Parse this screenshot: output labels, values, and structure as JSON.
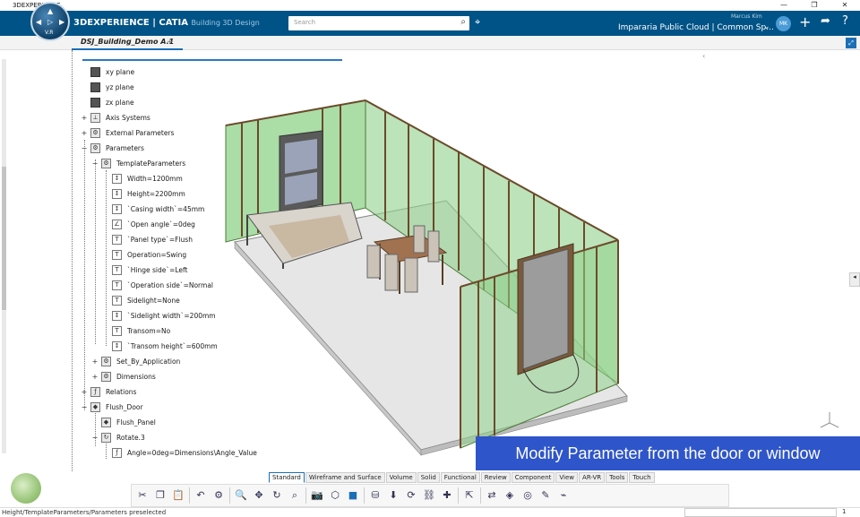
{
  "window": {
    "title": "3DEXPERIENCE",
    "controls": [
      "—",
      "❐",
      "✕"
    ]
  },
  "header": {
    "brand_main": "3DEXPERIENCE | CATIA",
    "brand_sub": "Building 3D Design",
    "search_placeholder": "Search",
    "user_name": "Marcus Kim",
    "collab_space": "Impararia Public Cloud | Common Sp...",
    "avatar_initials": "MK",
    "compass_version": "V.R"
  },
  "tabs": {
    "document": "DSJ_Building_Demo A.1",
    "add": "+"
  },
  "tree": [
    {
      "label": "xy plane",
      "icon": "plane-icon",
      "expander": ""
    },
    {
      "label": "yz plane",
      "icon": "plane-icon",
      "expander": ""
    },
    {
      "label": "zx plane",
      "icon": "plane-icon",
      "expander": ""
    },
    {
      "label": "Axis Systems",
      "icon": "axis-icon",
      "expander": "+"
    },
    {
      "label": "External Parameters",
      "icon": "parameters-icon",
      "expander": "+"
    },
    {
      "label": "Parameters",
      "icon": "parameters-icon",
      "expander": "−"
    },
    {
      "label": "TemplateParameters",
      "icon": "parameters-icon",
      "expander": "−"
    },
    {
      "label": "Width=1200mm",
      "icon": "length-param-icon",
      "expander": ""
    },
    {
      "label": "Height=2200mm",
      "icon": "length-param-icon",
      "expander": ""
    },
    {
      "label": "`Casing width`=45mm",
      "icon": "length-param-icon",
      "expander": ""
    },
    {
      "label": "`Open angle`=0deg",
      "icon": "angle-param-icon",
      "expander": ""
    },
    {
      "label": "`Panel type`=Flush",
      "icon": "string-param-icon",
      "expander": ""
    },
    {
      "label": "Operation=Swing",
      "icon": "string-param-icon",
      "expander": ""
    },
    {
      "label": "`Hinge side`=Left",
      "icon": "string-param-icon",
      "expander": ""
    },
    {
      "label": "`Operation side`=Normal",
      "icon": "string-param-icon",
      "expander": ""
    },
    {
      "label": "Sidelight=None",
      "icon": "string-param-icon",
      "expander": ""
    },
    {
      "label": "`Sidelight width`=200mm",
      "icon": "length-param-icon",
      "expander": ""
    },
    {
      "label": "Transom=No",
      "icon": "string-param-icon",
      "expander": ""
    },
    {
      "label": "`Transom height`=600mm",
      "icon": "length-param-icon",
      "expander": ""
    },
    {
      "label": "Set_By_Application",
      "icon": "parameters-icon",
      "expander": "+"
    },
    {
      "label": "Dimensions",
      "icon": "parameters-icon",
      "expander": "+"
    },
    {
      "label": "Relations",
      "icon": "relations-icon",
      "expander": "+"
    },
    {
      "label": "Flush_Door",
      "icon": "part-icon",
      "expander": "−"
    },
    {
      "label": "Flush_Panel",
      "icon": "part-icon",
      "expander": ""
    },
    {
      "label": "Rotate.3",
      "icon": "rotate-icon",
      "expander": "−"
    },
    {
      "label": "Angle=0deg=Dimensions\\Angle_Value",
      "icon": "formula-icon",
      "expander": ""
    }
  ],
  "caption": "Modify Parameter from the door or window",
  "section_tabs": [
    "Standard",
    "Wireframe and Surface",
    "Volume",
    "Solid",
    "Functional",
    "Review",
    "Component",
    "View",
    "AR-VR",
    "Tools",
    "Touch"
  ],
  "active_section": "Standard",
  "toolbar_icons": [
    "cut-icon",
    "copy-icon",
    "paste-icon",
    "undo-icon",
    "settings-icon",
    "zoom-icon",
    "pan-icon",
    "rotate-view-icon",
    "zoom-area-icon",
    "capture-icon",
    "view-cube-icon",
    "render-style-icon",
    "database-icon",
    "save-icon",
    "refresh-icon",
    "link-icon",
    "plus-icon",
    "move-icon",
    "measure-icon",
    "probe-icon",
    "visibility-icon",
    "annotation-icon",
    "sketch-icon"
  ],
  "status": {
    "text": "Height/TemplateParameters/Parameters preselected",
    "right": "1"
  },
  "colors": {
    "brand_blue": "#005386",
    "caption_blue": "#2e55c9",
    "wall_green": "#8fd18a",
    "stud_brown": "#6b4a2a"
  }
}
